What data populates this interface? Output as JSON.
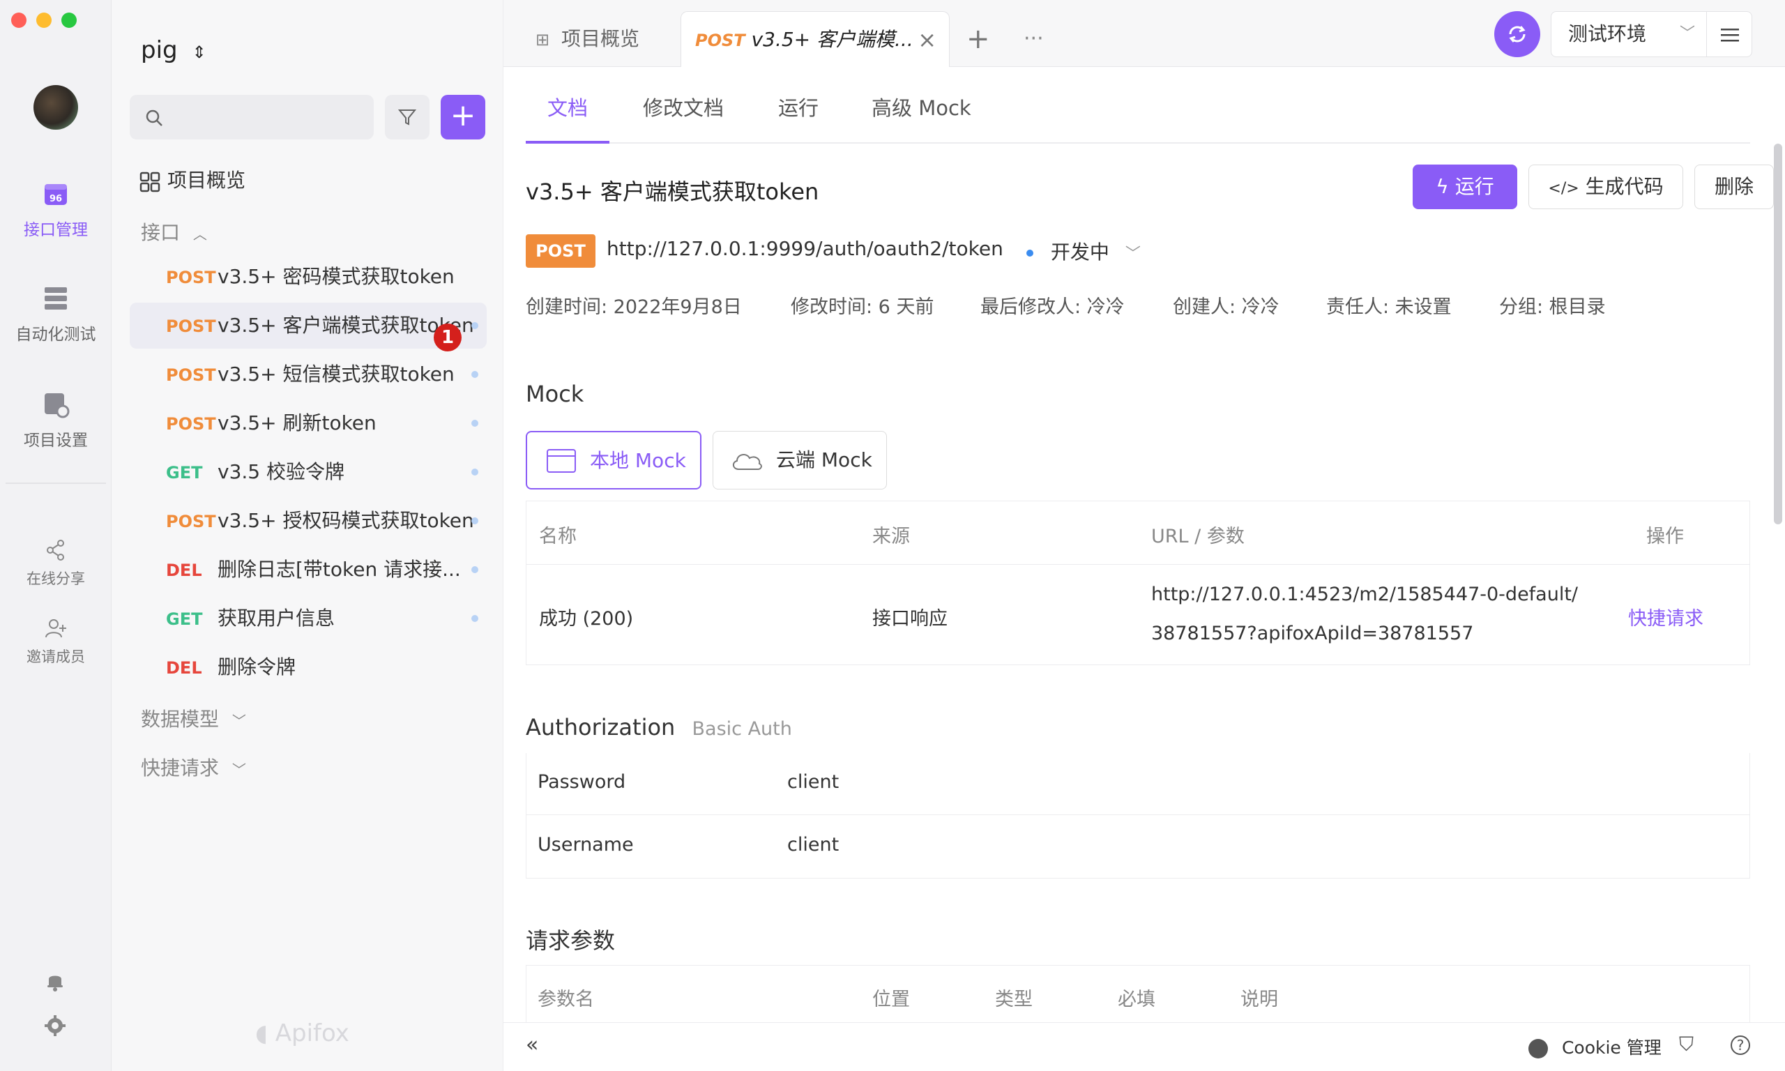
{
  "window": {
    "traffic_lights": [
      "#ff5f57",
      "#febc2e",
      "#28c840"
    ]
  },
  "rail": {
    "items": [
      {
        "label": "接口管理",
        "icon": "api-icon",
        "active": true
      },
      {
        "label": "自动化测试",
        "icon": "automation-icon",
        "active": false
      },
      {
        "label": "项目设置",
        "icon": "settings-doc-icon",
        "active": false
      }
    ],
    "small_items": [
      {
        "label": "在线分享",
        "icon": "share-icon"
      },
      {
        "label": "邀请成员",
        "icon": "invite-user-icon"
      }
    ],
    "bottom_icons": [
      "bell-icon",
      "gear-icon"
    ]
  },
  "sidebar": {
    "project_name": "pig",
    "overview_label": "项目概览",
    "section_api": "接口",
    "section_models": "数据模型",
    "section_quick": "快捷请求",
    "badge": "1",
    "watermark": "Apifox",
    "items": [
      {
        "method": "POST",
        "name": "v3.5+ 密码模式获取token",
        "dot": false
      },
      {
        "method": "POST",
        "name": "v3.5+ 客户端模式获取token",
        "dot": true,
        "selected": true
      },
      {
        "method": "POST",
        "name": "v3.5+ 短信模式获取token",
        "dot": true
      },
      {
        "method": "POST",
        "name": "v3.5+ 刷新token",
        "dot": true
      },
      {
        "method": "GET",
        "name": "v3.5 校验令牌",
        "dot": true
      },
      {
        "method": "POST",
        "name": "v3.5+ 授权码模式获取token",
        "dot": true
      },
      {
        "method": "DEL",
        "name": "删除日志[带token 请求接...",
        "dot": true
      },
      {
        "method": "GET",
        "name": "获取用户信息",
        "dot": true
      },
      {
        "method": "DEL",
        "name": "删除令牌",
        "dot": false
      }
    ]
  },
  "tabs": {
    "overview": "项目概览",
    "active_method": "POST",
    "active_title": "v3.5+ 客户端模...",
    "env": "测试环境"
  },
  "subtabs": [
    "文档",
    "修改文档",
    "运行",
    "高级 Mock"
  ],
  "api": {
    "title": "v3.5+ 客户端模式获取token",
    "run_label": "运行",
    "gen_label": "生成代码",
    "delete_label": "删除",
    "method": "POST",
    "url": "http://127.0.0.1:9999/auth/oauth2/token",
    "status": "开发中",
    "meta": {
      "created": "创建时间: 2022年9月8日",
      "modified": "修改时间: 6 天前",
      "last_editor": "最后修改人: 冷冷",
      "creator": "创建人: 冷冷",
      "owner": "责任人: 未设置",
      "group": "分组: 根目录"
    }
  },
  "mock": {
    "heading": "Mock",
    "local_label": "本地 Mock",
    "cloud_label": "云端 Mock",
    "headers": [
      "名称",
      "来源",
      "URL / 参数",
      "操作"
    ],
    "row": {
      "name": "成功 (200)",
      "source": "接口响应",
      "url_line1": "http://127.0.0.1:4523/m2/1585447-0-default/",
      "url_line2": "38781557?apifoxApiId=38781557",
      "action": "快捷请求"
    }
  },
  "auth": {
    "heading": "Authorization",
    "type": "Basic Auth",
    "rows": [
      {
        "key": "Password",
        "value": "client"
      },
      {
        "key": "Username",
        "value": "client"
      }
    ]
  },
  "params": {
    "heading": "请求参数",
    "headers": [
      "参数名",
      "位置",
      "类型",
      "必填",
      "说明"
    ]
  },
  "bottom": {
    "cookie_label": "Cookie 管理"
  },
  "colors": {
    "accent": "#8a5cf6",
    "post": "#f08c3a",
    "get": "#3cbf8a",
    "del": "#e6463c"
  }
}
